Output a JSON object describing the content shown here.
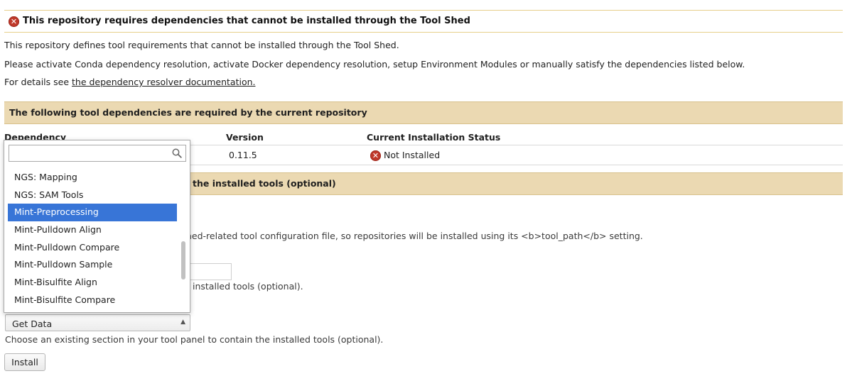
{
  "warning": {
    "title": "This repository requires dependencies that cannot be installed through the Tool Shed",
    "line1": "This repository defines tool requirements that cannot be installed through the Tool Shed.",
    "line2": "Please activate Conda dependency resolution, activate Docker dependency resolution, setup Environment Modules or manually satisfy the dependencies listed below.",
    "details_prefix": "For details see ",
    "details_link": "the dependency resolver documentation."
  },
  "dependencies": {
    "heading": "The following tool dependencies are required by the current repository",
    "columns": [
      "Dependency",
      "Version",
      "Current Installation Status"
    ],
    "rows": [
      {
        "name": "",
        "version": "0.11.5",
        "status": "Not Installed"
      }
    ]
  },
  "panel_section": {
    "heading": "the installed tools (optional)",
    "config_note": "hed-related tool configuration file, so repositories will be installed using its <b>tool_path</b> setting.",
    "new_section_hint": "installed tools (optional).",
    "existing_section_hint": "Choose an existing section in your tool panel to contain the installed tools (optional)."
  },
  "section_select": {
    "selected": "Get Data",
    "search_placeholder": "",
    "options": [
      "NGS: Mapping",
      "NGS: SAM Tools",
      "Mint-Preprocessing",
      "Mint-Pulldown Align",
      "Mint-Pulldown Compare",
      "Mint-Pulldown Sample",
      "Mint-Bisulfite Align",
      "Mint-Bisulfite Compare"
    ],
    "highlighted_index": 2
  },
  "install_button": "Install",
  "icons": {
    "error": "error-x-icon",
    "search": "magnifier-icon",
    "caret": "caret-up-icon"
  },
  "colors": {
    "section_header_bg": "#ebd9b2",
    "highlight": "#3875d7",
    "error": "#c0392b"
  }
}
